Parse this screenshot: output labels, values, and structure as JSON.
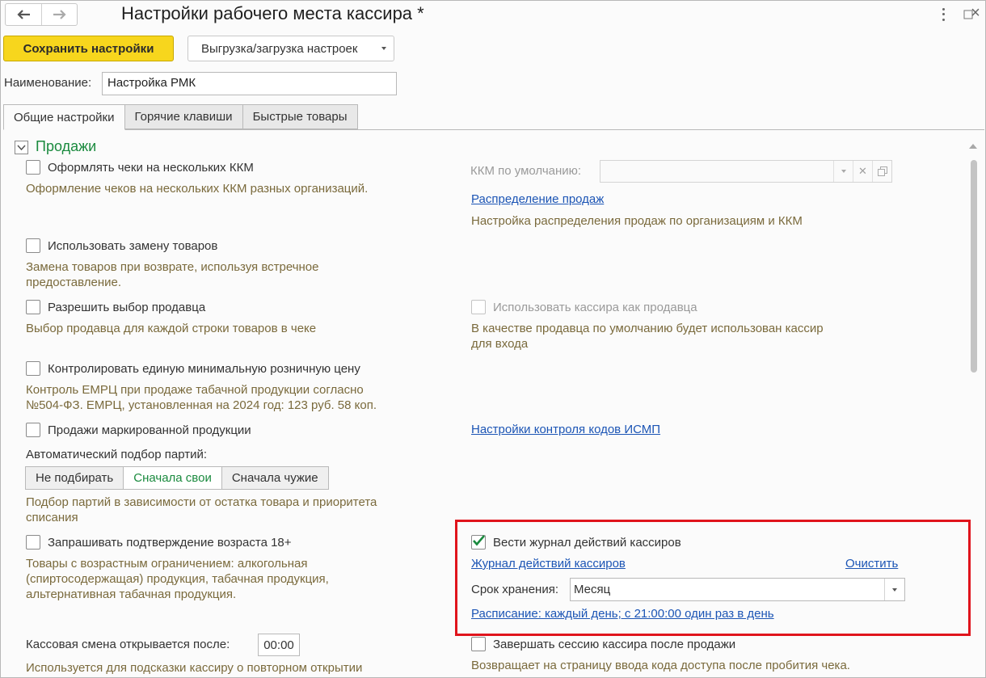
{
  "window": {
    "title": "Настройки рабочего места кассира *",
    "kebab_icon": "more-vertical-icon",
    "expand_icon": "expand-icon",
    "close_glyph": "×"
  },
  "toolbar": {
    "save_label": "Сохранить настройки",
    "upload_label": "Выгрузка/загрузка настроек"
  },
  "name_field": {
    "label": "Наименование:",
    "value": "Настройка РМК"
  },
  "tabs": [
    {
      "label": "Общие настройки",
      "active": true
    },
    {
      "label": "Горячие клавиши",
      "active": false
    },
    {
      "label": "Быстрые товары",
      "active": false
    }
  ],
  "section": {
    "title": "Продажи"
  },
  "left": {
    "multi_kkm": {
      "label": "Оформлять чеки на нескольких ККМ",
      "hint": "Оформление чеков на нескольких ККМ разных организаций.",
      "checked": false
    },
    "replace_goods": {
      "label": "Использовать замену товаров",
      "hint_1": "Замена товаров при возврате, используя встречное",
      "hint_2": "предоставление.",
      "checked": false
    },
    "seller_choice": {
      "label": "Разрешить выбор продавца",
      "hint": "Выбор продавца для каждой строки товаров в чеке",
      "checked": false
    },
    "min_price": {
      "label": "Контролировать единую минимальную розничную цену",
      "hint_1": "Контроль ЕМРЦ при продаже табачной продукции согласно",
      "hint_2": "№504-ФЗ. ЕМРЦ, установленная на 2024 год: 123 руб. 58 коп.",
      "checked": false
    },
    "marked_goods": {
      "label": "Продажи маркированной продукции",
      "checked": false
    },
    "batch_selection": {
      "label": "Автоматический подбор партий:",
      "options": [
        "Не подбирать",
        "Сначала свои",
        "Сначала чужие"
      ],
      "selected": "Сначала свои",
      "hint_1": "Подбор партий в зависимости от остатка товара и приоритета",
      "hint_2": "списания"
    },
    "age_confirm": {
      "label": "Запрашивать подтверждение возраста 18+",
      "hint_1": "Товары с возрастным ограничением: алкогольная",
      "hint_2": "(спиртосодержащая) продукция, табачная продукция,",
      "hint_3": "альтернативная табачная продукция.",
      "checked": false
    },
    "shift_open": {
      "label": "Кассовая смена открывается после:",
      "value": "00:00",
      "hint": "Используется для подсказки кассиру о повторном открытии"
    }
  },
  "right": {
    "default_kkm": {
      "label": "ККМ по умолчанию:",
      "value": ""
    },
    "sales_distribution": {
      "link": "Распределение продаж",
      "hint": "Настройка распределения продаж по организациям и ККМ"
    },
    "cashier_as_seller": {
      "label": "Использовать кассира как продавца",
      "hint_1": "В качестве продавца по умолчанию будет использован кассир",
      "hint_2": "для входа",
      "checked": false
    },
    "ismp_link": "Настройки контроля кодов ИСМП",
    "journal": {
      "label": "Вести журнал действий кассиров",
      "checked": true,
      "link": "Журнал действий кассиров",
      "clear_link": "Очистить",
      "retention_label": "Срок хранения:",
      "retention_value": "Месяц",
      "schedule_link": "Расписание: каждый день; с 21:00:00 один раз в день"
    },
    "end_session": {
      "label": "Завершать сессию кассира после продажи",
      "hint": "Возвращает на страницу ввода кода доступа после пробития чека.",
      "checked": false
    }
  },
  "colors": {
    "accent_green": "#1a8a3e",
    "save_yellow": "#f7d61d",
    "link_blue": "#1c55b5",
    "hint_brown": "#7a6a3c",
    "highlight_red": "#e0141c"
  }
}
